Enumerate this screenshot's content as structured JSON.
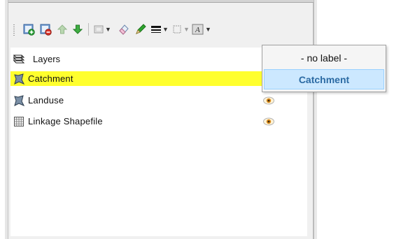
{
  "panel": {
    "header_label": "Layers",
    "layers": [
      {
        "name": "Catchment",
        "type": "polygon",
        "selected": true,
        "visible": false
      },
      {
        "name": "Landuse",
        "type": "polygon",
        "selected": false,
        "visible": true
      },
      {
        "name": "Linkage Shapefile",
        "type": "grid",
        "selected": false,
        "visible": true
      }
    ]
  },
  "toolbar": {
    "buttons": [
      "add-layer-icon",
      "remove-layer-icon",
      "move-up-icon",
      "move-down-icon",
      "layer-style-dropdown-icon",
      "eraser-icon",
      "pencil-icon",
      "line-width-dropdown-icon",
      "frame-dropdown-icon",
      "label-dropdown-icon"
    ]
  },
  "label_menu": {
    "items": [
      {
        "label": "- no label -",
        "highlighted": false
      },
      {
        "label": "Catchment",
        "highlighted": true
      }
    ]
  },
  "colors": {
    "selection": "#ffff2e",
    "menu_highlight": "#cce8ff",
    "menu_highlight_text": "#2b6aa3"
  }
}
